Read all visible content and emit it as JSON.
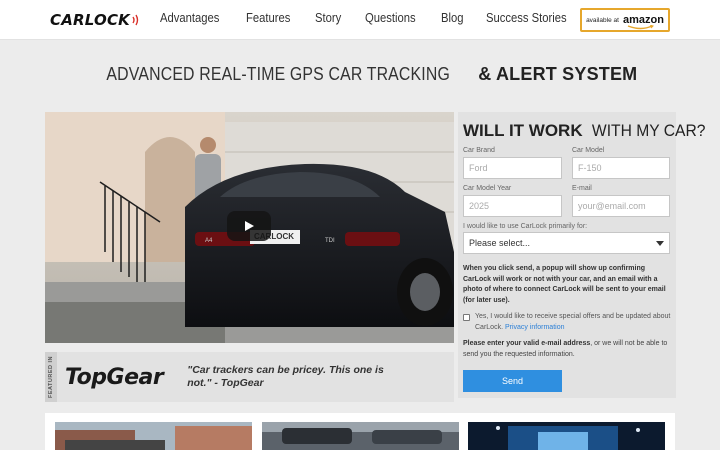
{
  "header": {
    "logo": "CARLOCK",
    "nav": [
      "Advantages",
      "Features",
      "Story",
      "Questions",
      "Blog",
      "Success Stories"
    ],
    "amazon_badge": {
      "small": "available at",
      "brand": "amazon"
    }
  },
  "headline": {
    "light": "ADVANCED REAL-TIME GPS CAR TRACKING",
    "bold": "& ALERT SYSTEM"
  },
  "video": {
    "plate_text": "CARLOCK",
    "badge_left": "A4",
    "badge_right": "TDI"
  },
  "featured": {
    "tab_label": "FEATURED IN",
    "outlet": "TopGear",
    "quote": "\"Car trackers can be pricey. This one is not.\" - TopGear"
  },
  "form": {
    "title_bold": "WILL IT WORK",
    "title_light": "WITH MY CAR?",
    "brand_label": "Car Brand",
    "brand_placeholder": "Ford",
    "model_label": "Car Model",
    "model_placeholder": "F-150",
    "year_label": "Car Model Year",
    "year_placeholder": "2025",
    "email_label": "E-mail",
    "email_placeholder": "your@email.com",
    "use_label": "I would like to use CarLock primarily for:",
    "use_selected": "Please select...",
    "note": "When you click send, a popup will show up confirming CarLock will work or not with your car, and an email with a photo of where to connect CarLock will be sent to your email (for later use).",
    "offers_text": "Yes, I would like to receive special offers and be updated about CarLock.",
    "privacy_link": "Privacy information",
    "warn_bold": "Please enter your valid e-mail address",
    "warn_rest": ", or we will not be able to send you the requested information.",
    "send_label": "Send"
  },
  "colors": {
    "accent": "#2f8fe0",
    "amazon_border": "#e6a72c",
    "logo_red": "#d9302a"
  }
}
